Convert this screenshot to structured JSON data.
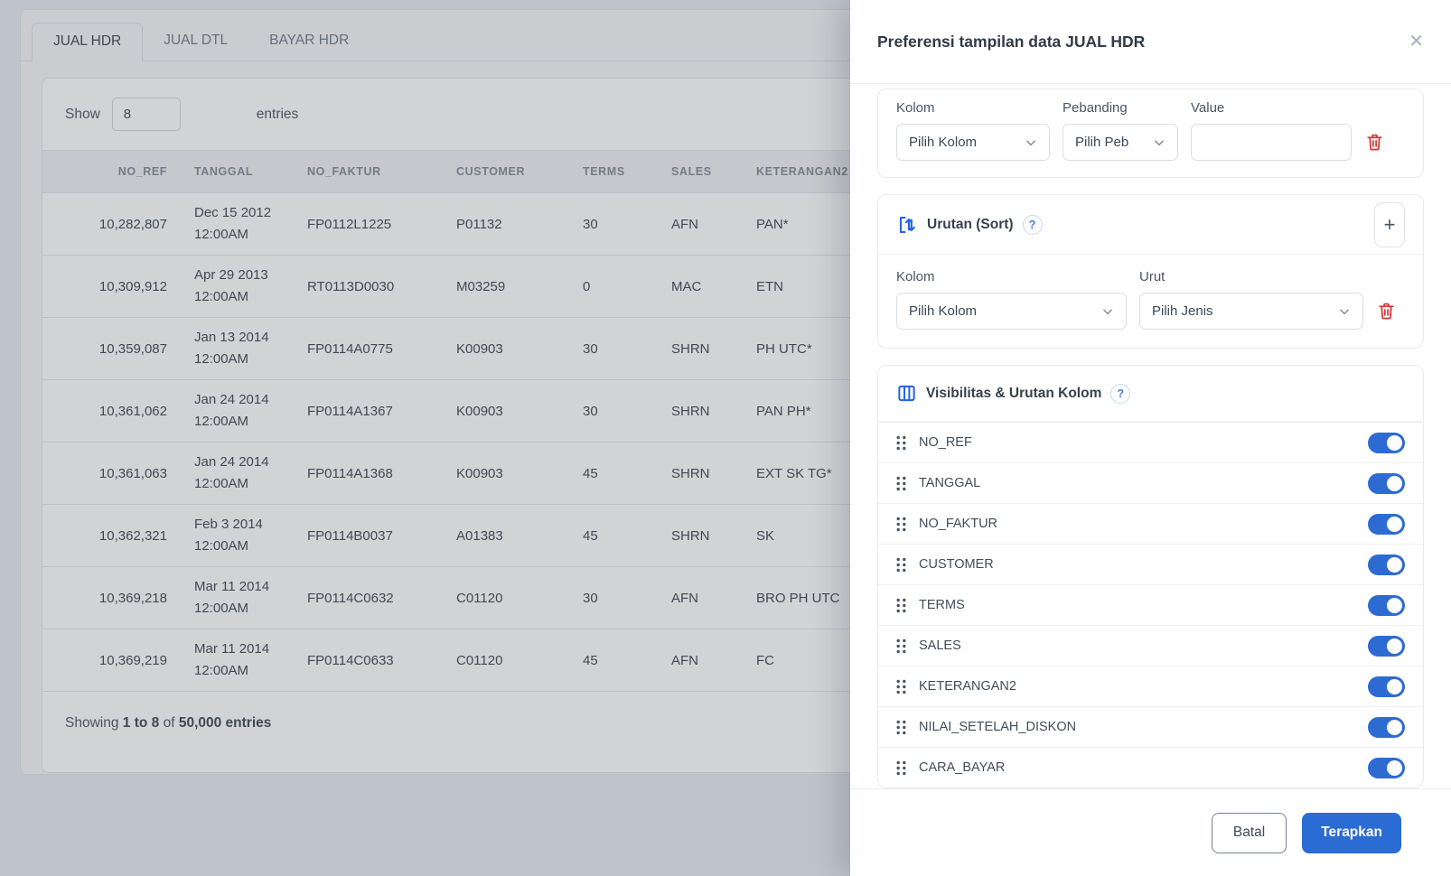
{
  "colors": {
    "accent": "#2d6bd2",
    "icon_blue": "#2563eb",
    "danger": "#d23b3b"
  },
  "main": {
    "tabs": [
      {
        "label": "JUAL HDR",
        "active": true
      },
      {
        "label": "JUAL DTL",
        "active": false
      },
      {
        "label": "BAYAR HDR",
        "active": false
      }
    ],
    "length": {
      "label": "Show",
      "value": "8",
      "suffix": "entries"
    },
    "table": {
      "columns": [
        {
          "key": "no_ref",
          "label": "NO_REF"
        },
        {
          "key": "tanggal",
          "label": "TANGGAL"
        },
        {
          "key": "no_faktur",
          "label": "NO_FAKTUR"
        },
        {
          "key": "customer",
          "label": "CUSTOMER"
        },
        {
          "key": "terms",
          "label": "TERMS"
        },
        {
          "key": "sales",
          "label": "SALES"
        },
        {
          "key": "keterangan2",
          "label": "KETERANGAN2"
        }
      ],
      "rows": [
        {
          "no_ref": "10,282,807",
          "date_line1": "Dec 15 2012",
          "date_line2": "12:00AM",
          "no_faktur": "FP0112L1225",
          "customer": "P01132",
          "terms": "30",
          "sales": "AFN",
          "keterangan2": "PAN*"
        },
        {
          "no_ref": "10,309,912",
          "date_line1": "Apr 29 2013",
          "date_line2": "12:00AM",
          "no_faktur": "RT0113D0030",
          "customer": "M03259",
          "terms": "0",
          "sales": "MAC",
          "keterangan2": "ETN"
        },
        {
          "no_ref": "10,359,087",
          "date_line1": "Jan 13 2014",
          "date_line2": "12:00AM",
          "no_faktur": "FP0114A0775",
          "customer": "K00903",
          "terms": "30",
          "sales": "SHRN",
          "keterangan2": "PH UTC*"
        },
        {
          "no_ref": "10,361,062",
          "date_line1": "Jan 24 2014",
          "date_line2": "12:00AM",
          "no_faktur": "FP0114A1367",
          "customer": "K00903",
          "terms": "30",
          "sales": "SHRN",
          "keterangan2": "PAN PH*"
        },
        {
          "no_ref": "10,361,063",
          "date_line1": "Jan 24 2014",
          "date_line2": "12:00AM",
          "no_faktur": "FP0114A1368",
          "customer": "K00903",
          "terms": "45",
          "sales": "SHRN",
          "keterangan2": "EXT SK TG*"
        },
        {
          "no_ref": "10,362,321",
          "date_line1": "Feb 3 2014",
          "date_line2": "12:00AM",
          "no_faktur": "FP0114B0037",
          "customer": "A01383",
          "terms": "45",
          "sales": "SHRN",
          "keterangan2": "SK"
        },
        {
          "no_ref": "10,369,218",
          "date_line1": "Mar 11 2014",
          "date_line2": "12:00AM",
          "no_faktur": "FP0114C0632",
          "customer": "C01120",
          "terms": "30",
          "sales": "AFN",
          "keterangan2": "BRO PH UTC"
        },
        {
          "no_ref": "10,369,219",
          "date_line1": "Mar 11 2014",
          "date_line2": "12:00AM",
          "no_faktur": "FP0114C0633",
          "customer": "C01120",
          "terms": "45",
          "sales": "AFN",
          "keterangan2": "FC"
        }
      ]
    },
    "info": {
      "prefix": "Showing",
      "range": "1 to 8",
      "of": "of",
      "total": "50,000 entries"
    }
  },
  "panel": {
    "title": "Preferensi tampilan data JUAL HDR",
    "close": "✕",
    "filter": {
      "kolom_label": "Kolom",
      "pebanding_label": "Pebanding",
      "value_label": "Value",
      "kolom_placeholder": "Pilih Kolom",
      "pebanding_placeholder": "Pilih Peb",
      "value": ""
    },
    "sort": {
      "title": "Urutan (Sort)",
      "help": "?",
      "add": "+",
      "kolom_label": "Kolom",
      "urut_label": "Urut",
      "kolom_placeholder": "Pilih Kolom",
      "urut_placeholder": "Pilih Jenis"
    },
    "visibility": {
      "title": "Visibilitas & Urutan Kolom",
      "help": "?",
      "columns": [
        {
          "label": "NO_REF",
          "enabled": true
        },
        {
          "label": "TANGGAL",
          "enabled": true
        },
        {
          "label": "NO_FAKTUR",
          "enabled": true
        },
        {
          "label": "CUSTOMER",
          "enabled": true
        },
        {
          "label": "TERMS",
          "enabled": true
        },
        {
          "label": "SALES",
          "enabled": true
        },
        {
          "label": "KETERANGAN2",
          "enabled": true
        },
        {
          "label": "NILAI_SETELAH_DISKON",
          "enabled": true
        },
        {
          "label": "CARA_BAYAR",
          "enabled": true
        }
      ]
    },
    "footer": {
      "cancel": "Batal",
      "apply": "Terapkan"
    }
  }
}
